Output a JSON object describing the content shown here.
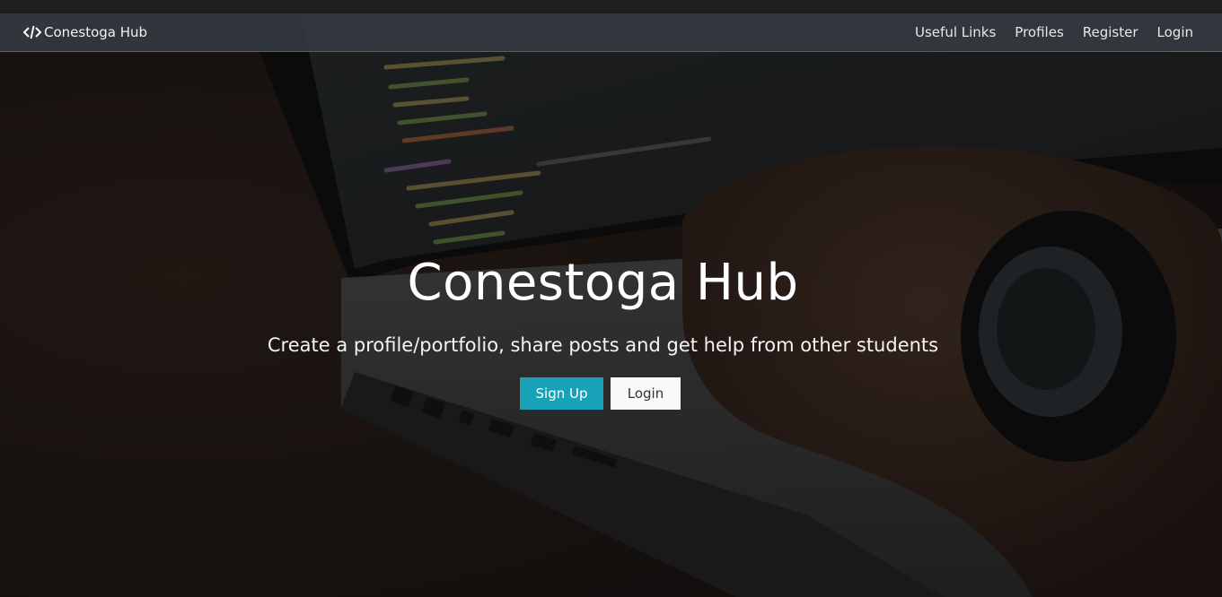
{
  "navbar": {
    "brand": "Conestoga Hub",
    "brand_icon": "code-icon",
    "links": [
      "Useful Links",
      "Profiles",
      "Register",
      "Login"
    ]
  },
  "hero": {
    "title": "Conestoga Hub",
    "subtitle": "Create a profile/portfolio, share posts and get help from other students",
    "buttons": {
      "signup": "Sign Up",
      "login": "Login"
    }
  },
  "colors": {
    "navbar_bg": "#343a40",
    "accent": "#17a2b8",
    "light_button": "#f8f9fa"
  }
}
